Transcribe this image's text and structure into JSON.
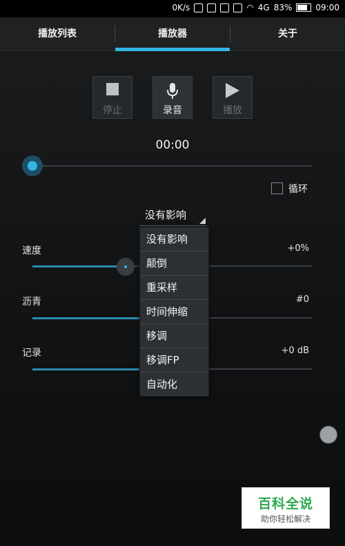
{
  "status_bar": {
    "network_speed": "0K/s",
    "signal": "4G",
    "battery": "83%",
    "time": "09:00"
  },
  "tabs": [
    {
      "label": "播放列表"
    },
    {
      "label": "播放器"
    },
    {
      "label": "关于"
    }
  ],
  "transport": {
    "stop_label": "停止",
    "record_label": "录音",
    "play_label": "播放"
  },
  "time_display": "00:00",
  "playback_progress": 0,
  "loop": {
    "label": "循环",
    "checked": false
  },
  "effect_spinner": {
    "selected": "没有影响"
  },
  "effect_menu": {
    "items": [
      "没有影响",
      "颠倒",
      "重采样",
      "时间伸缩",
      "移调",
      "移调FP",
      "自动化"
    ]
  },
  "controls": {
    "speed": {
      "label": "速度",
      "value": "+0%"
    },
    "pitch": {
      "label": "沥青",
      "value": "#0"
    },
    "record": {
      "label": "记录",
      "value": "+0 dB"
    }
  },
  "watermark": {
    "title": "百科全说",
    "subtitle": "助你轻松解决"
  },
  "colors": {
    "accent": "#33b5e5",
    "background": "#111315"
  }
}
